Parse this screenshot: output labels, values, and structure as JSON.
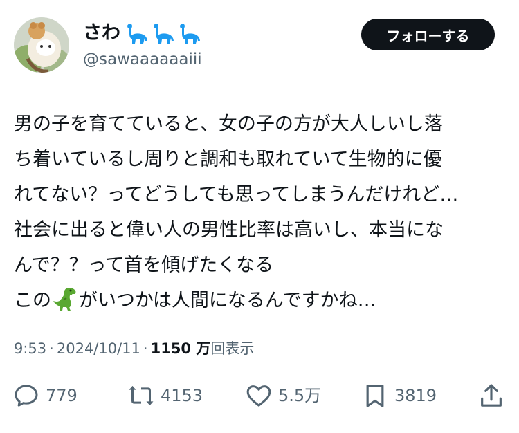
{
  "user": {
    "display_name": "さわ",
    "handle": "@sawaaaaaaiii",
    "name_emojis": [
      "sauropod-icon",
      "sauropod-icon",
      "sauropod-icon"
    ]
  },
  "follow_button": {
    "label": "フォローする"
  },
  "tweet": {
    "lines": [
      "男の子を育てていると、女の子の方が大人しいし落",
      "ち着いているし周りと調和も取れていて生物的に優",
      "れてない？ってどうしても思ってしまうんだけれど…",
      "社会に出ると偉い人の男性比率は高いし、本当にな",
      "んで？？って首を傾げたくなる"
    ],
    "last_line_before": "この",
    "last_line_emoji": "t-rex-icon",
    "last_line_after": "がいつかは人間になるんですかね…"
  },
  "meta": {
    "time": "9:53",
    "separator": "·",
    "date": "2024/10/11",
    "views_count": "1150 万",
    "views_label": "回表示"
  },
  "actions": {
    "replies": "779",
    "reposts": "4153",
    "likes": "5.5万",
    "bookmarks": "3819"
  },
  "colors": {
    "text": "#0f1419",
    "secondary": "#536471",
    "button_bg": "#0f1419",
    "dino": "#1d9bf0"
  }
}
